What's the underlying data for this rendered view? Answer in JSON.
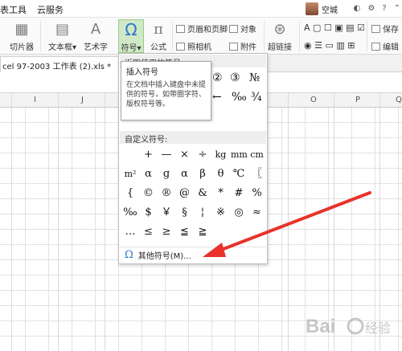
{
  "menubar": {
    "left_item": "表工具",
    "cloud": "云服务",
    "user_name": "空城"
  },
  "ribbon": {
    "cut_label": "切片器",
    "textbox_label": "文本框",
    "textbox_arrow": "▾",
    "wordart_label": "艺术字",
    "symbol_label": "符号",
    "formula_label": "公式",
    "header_footer": "页眉和页脚",
    "object": "对象",
    "camera": "照相机",
    "attachment": "附件",
    "hyperlink": "超链接",
    "right_top": "保存",
    "right_bottom": "编辑"
  },
  "tab": {
    "doc_title": "cel 97-2003 工作表 (2).xls *"
  },
  "columns": [
    "I",
    "J",
    "O",
    "P",
    "Q"
  ],
  "dropdown": {
    "recent_header": "近期使用的符号",
    "recent_symbols": [
      "②",
      "③",
      "№"
    ],
    "recent_row2": [
      "←",
      "‰",
      "¾"
    ],
    "custom_header": "自定义符号:",
    "symbols": [
      [
        "",
        "+",
        "—",
        "×",
        "÷",
        "kg",
        "mm",
        "cm"
      ],
      [
        "m²",
        "α",
        "g",
        "α",
        "β",
        "θ",
        "℃",
        "〖"
      ],
      [
        "{",
        "©",
        "®",
        "@",
        "&",
        "*",
        "#",
        "%"
      ],
      [
        "‰",
        "$",
        "￥",
        "§",
        "¦",
        "※",
        "◎",
        "≈"
      ],
      [
        "…",
        "≤",
        "≥",
        "≦",
        "≧",
        "",
        "",
        ""
      ]
    ],
    "other_label": "其他符号(M)..."
  },
  "tooltip": {
    "title": "插入符号",
    "desc": "在文档中插入键盘中未提供的符号，如带圈字符、版权符号等。"
  },
  "colors": {
    "accent": "#2e77c7",
    "arrow": "#e8322b",
    "symbol_highlight": "#cfe8c6"
  }
}
